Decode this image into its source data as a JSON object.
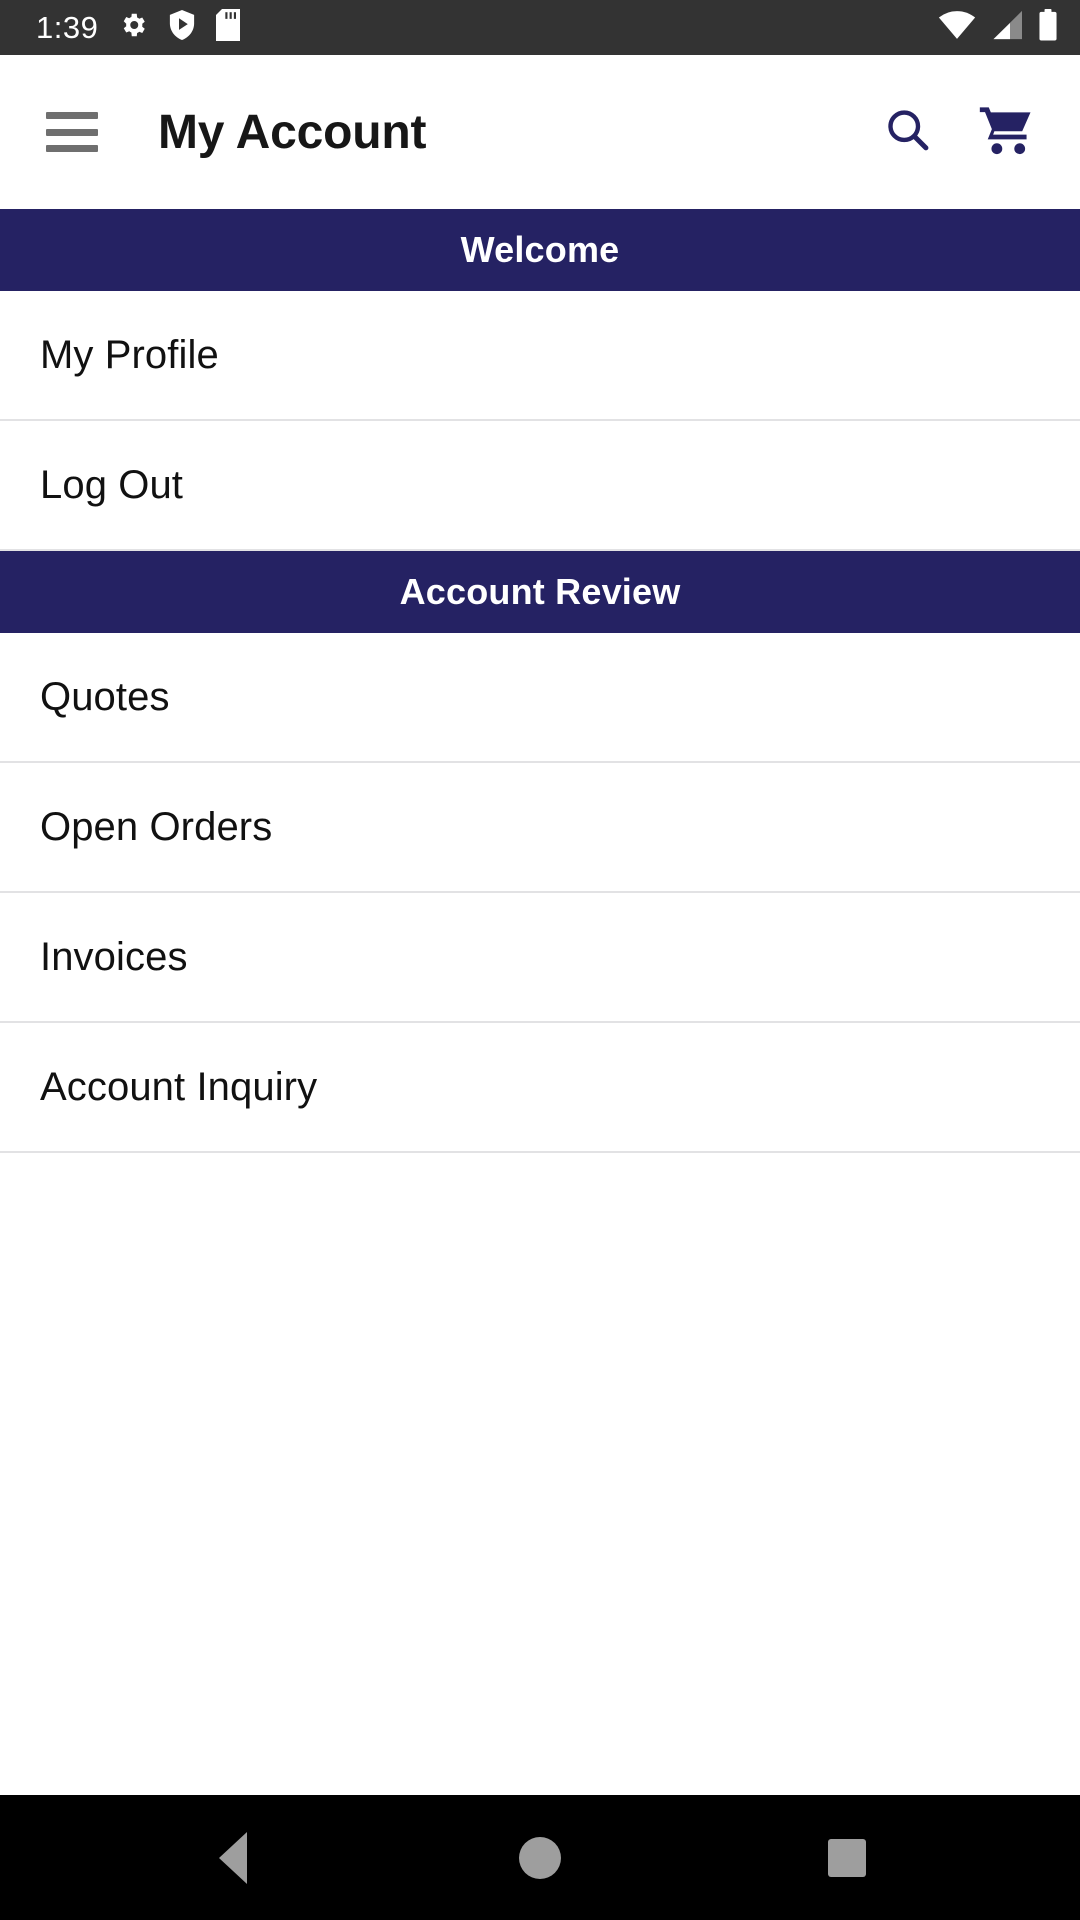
{
  "status_bar": {
    "time": "1:39",
    "left_icons": [
      "gear-icon",
      "shield-play-icon",
      "sd-card-icon"
    ],
    "right_icons": [
      "wifi-icon",
      "cellular-signal-icon",
      "battery-icon"
    ],
    "background": "#333333",
    "foreground": "#ffffff"
  },
  "app_bar": {
    "menu_icon": "hamburger-menu-icon",
    "title": "My Account",
    "actions": [
      {
        "icon": "search-icon",
        "label": "Search"
      },
      {
        "icon": "shopping-cart-icon",
        "label": "Cart"
      }
    ],
    "accent_color": "#252263",
    "menu_color": "#6f6f6f"
  },
  "sections": [
    {
      "header": "Welcome",
      "items": [
        {
          "label": "My Profile"
        },
        {
          "label": "Log Out"
        }
      ]
    },
    {
      "header": "Account Review",
      "items": [
        {
          "label": "Quotes"
        },
        {
          "label": "Open Orders"
        },
        {
          "label": "Invoices"
        },
        {
          "label": "Account Inquiry"
        }
      ]
    }
  ],
  "nav_bar": {
    "background": "#000000",
    "icon_color": "#9e9e9e",
    "buttons": [
      {
        "icon": "back-triangle-icon",
        "label": "Back"
      },
      {
        "icon": "home-circle-icon",
        "label": "Home"
      },
      {
        "icon": "recents-square-icon",
        "label": "Recents"
      }
    ]
  }
}
